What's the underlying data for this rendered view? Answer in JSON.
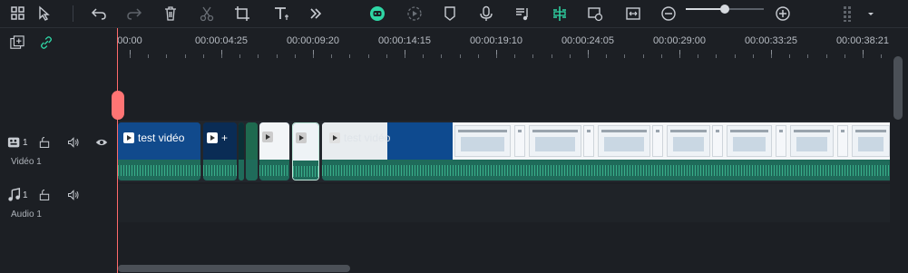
{
  "toolbar": {
    "icons": [
      {
        "name": "layout-icon"
      },
      {
        "name": "select-tool-icon"
      },
      {
        "name": "undo-icon"
      },
      {
        "name": "redo-icon"
      },
      {
        "name": "delete-icon"
      },
      {
        "name": "cut-icon"
      },
      {
        "name": "crop-icon"
      },
      {
        "name": "text-icon"
      },
      {
        "name": "more-icon"
      },
      {
        "name": "ai-avatar-icon"
      },
      {
        "name": "speed-icon"
      },
      {
        "name": "marker-icon"
      },
      {
        "name": "microphone-icon"
      },
      {
        "name": "music-note-icon"
      },
      {
        "name": "split-icon"
      },
      {
        "name": "preview-render-icon"
      },
      {
        "name": "fit-icon"
      },
      {
        "name": "zoom-out-icon"
      },
      {
        "name": "zoom-in-icon"
      },
      {
        "name": "grid-menu-icon"
      }
    ],
    "zoom_level": 0.5,
    "accent_color": "#2fd6a5"
  },
  "left_panel": {
    "video_track": {
      "label": "Vidéo 1",
      "count": "1"
    },
    "audio_track": {
      "label": "Audio 1",
      "count": "1"
    }
  },
  "ruler": {
    "labels": [
      "00:00",
      "00:00:04:25",
      "00:00:09:20",
      "00:00:14:15",
      "00:00:19:10",
      "00:00:24:05",
      "00:00:29:00",
      "00:00:33:25",
      "00:00:38:21"
    ]
  },
  "clips": [
    {
      "title": "test vidéo"
    },
    {
      "title": "+"
    },
    {
      "title": ""
    },
    {
      "title": ""
    },
    {
      "title": ""
    },
    {
      "title": "test vidéo"
    }
  ],
  "colors": {
    "playhead": "#ff6a6a",
    "clip_blue": "#114a8c",
    "audio_green": "#3cb58f"
  }
}
